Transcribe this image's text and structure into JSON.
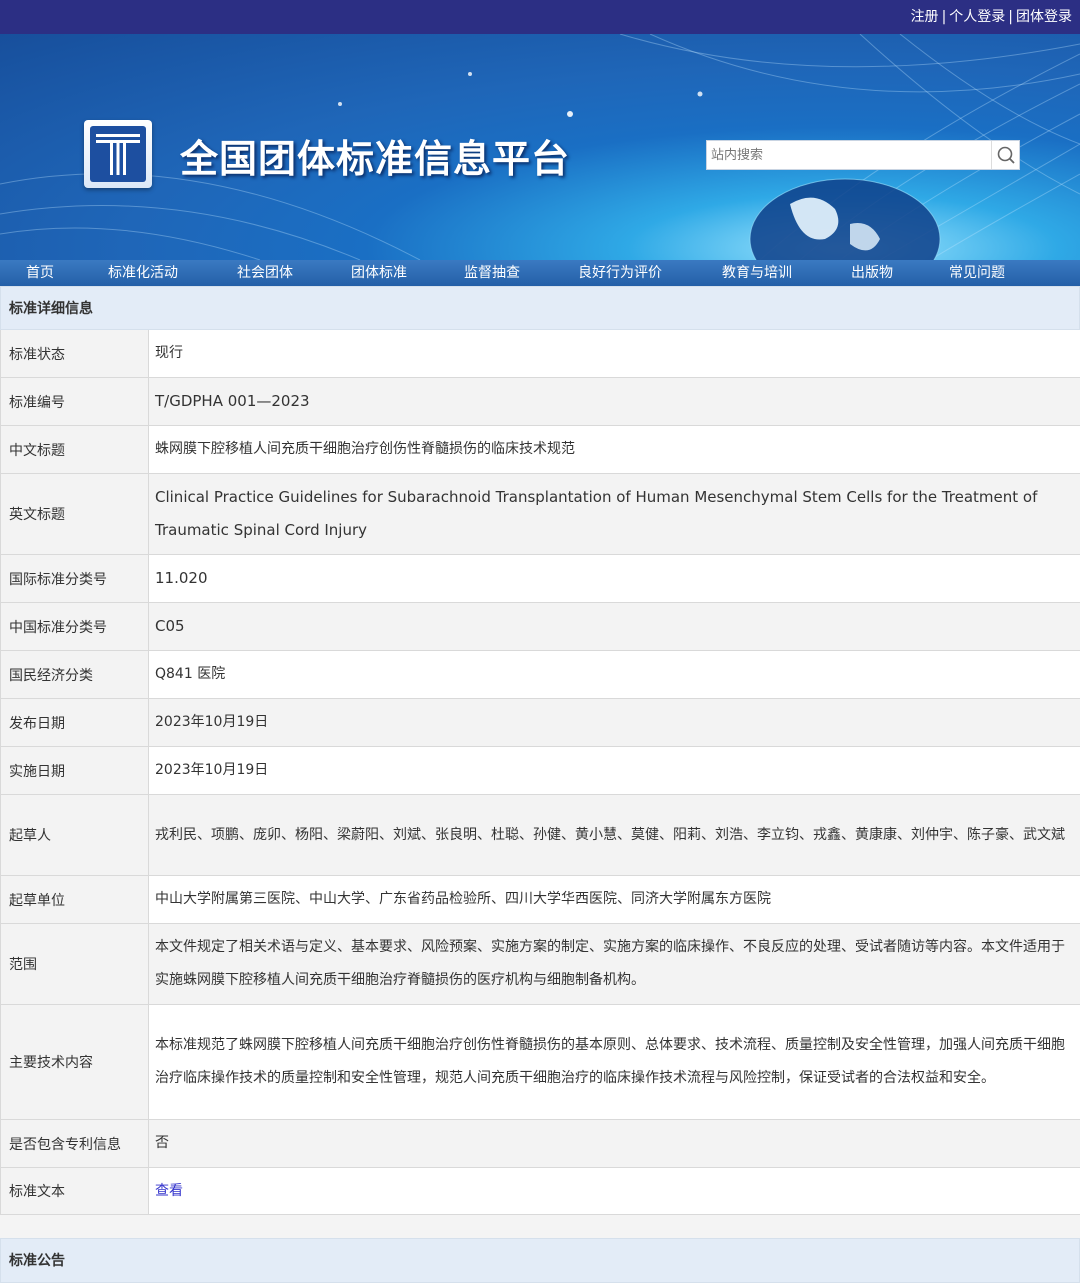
{
  "header": {
    "links": [
      "注册",
      "个人登录",
      "团体登录"
    ],
    "site_title": "全国团体标准信息平台",
    "search_placeholder": "站内搜索"
  },
  "nav": [
    "首页",
    "标准化活动",
    "社会团体",
    "团体标准",
    "监督抽查",
    "良好行为评价",
    "教育与培训",
    "出版物",
    "常见问题"
  ],
  "detail": {
    "section_title": "标准详细信息",
    "rows": [
      {
        "label": "标准状态",
        "value": "现行"
      },
      {
        "label": "标准编号",
        "value": "T/GDPHA 001—2023"
      },
      {
        "label": "中文标题",
        "value": "蛛网膜下腔移植人间充质干细胞治疗创伤性脊髓损伤的临床技术规范"
      },
      {
        "label": "英文标题",
        "value": "Clinical Practice Guidelines for Subarachnoid Transplantation of Human Mesenchymal Stem Cells for the Treatment of Traumatic Spinal Cord Injury"
      },
      {
        "label": "国际标准分类号",
        "value": "11.020"
      },
      {
        "label": "中国标准分类号",
        "value": "C05"
      },
      {
        "label": "国民经济分类",
        "value": "Q841 医院"
      },
      {
        "label": "发布日期",
        "value": "2023年10月19日"
      },
      {
        "label": "实施日期",
        "value": "2023年10月19日"
      },
      {
        "label": "起草人",
        "value": "戎利民、项鹏、庞卯、杨阳、梁蔚阳、刘斌、张良明、杜聪、孙健、黄小慧、莫健、阳莉、刘浩、李立钧、戎鑫、黄康康、刘仲宇、陈子豪、武文斌"
      },
      {
        "label": "起草单位",
        "value": "中山大学附属第三医院、中山大学、广东省药品检验所、四川大学华西医院、同济大学附属东方医院"
      },
      {
        "label": "范围",
        "value": "本文件规定了相关术语与定义、基本要求、风险预案、实施方案的制定、实施方案的临床操作、不良反应的处理、受试者随访等内容。本文件适用于实施蛛网膜下腔移植人间充质干细胞治疗脊髓损伤的医疗机构与细胞制备机构。"
      },
      {
        "label": "主要技术内容",
        "value": "本标准规范了蛛网膜下腔移植人间充质干细胞治疗创伤性脊髓损伤的基本原则、总体要求、技术流程、质量控制及安全性管理，加强人间充质干细胞治疗临床操作技术的质量控制和安全性管理，规范人间充质干细胞治疗的临床操作技术流程与风险控制，保证受试者的合法权益和安全。"
      },
      {
        "label": "是否包含专利信息",
        "value": "否"
      },
      {
        "label": "标准文本",
        "value": "查看"
      }
    ]
  },
  "notice": {
    "section_title": "标准公告"
  }
}
